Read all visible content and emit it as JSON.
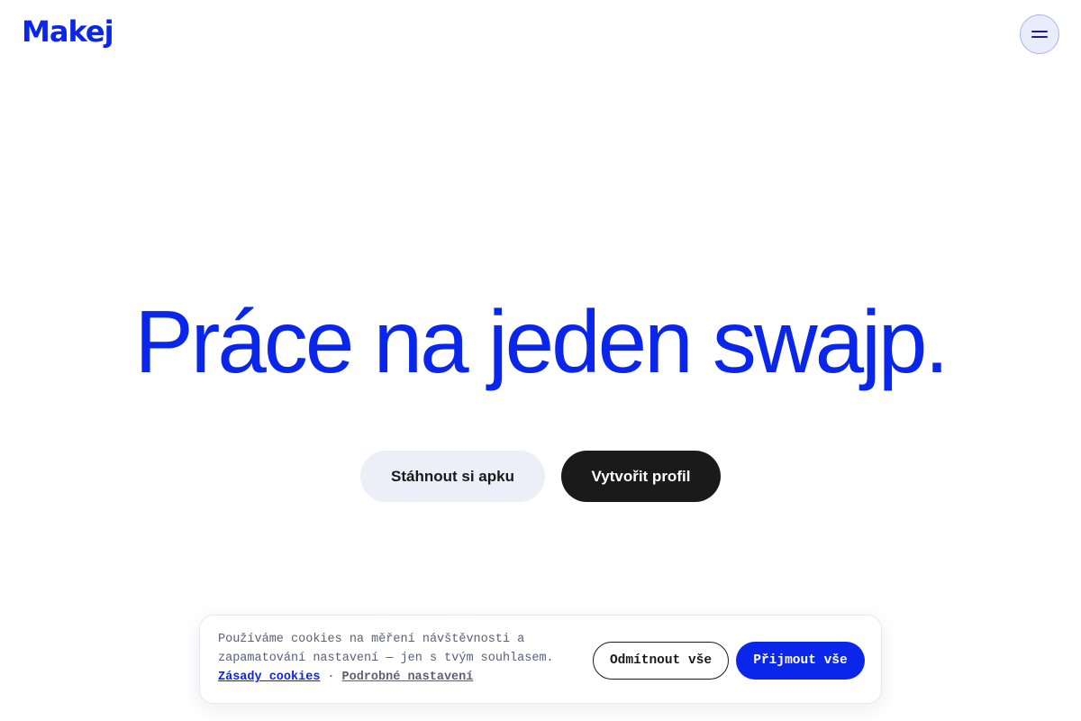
{
  "header": {
    "logo": "Makej",
    "menu_icon": "hamburger-menu-icon"
  },
  "hero": {
    "title": "Práce na jeden swajp.",
    "download_button": "Stáhnout si apku",
    "create_profile_button": "Vytvořit profil"
  },
  "cookie_banner": {
    "text": "Používáme cookies na měření návštěvnosti a zapamatování nastavení — jen s tvým souhlasem.",
    "policy_link": "Zásady cookies",
    "separator": "·",
    "settings_link": "Podrobné nastavení",
    "reject_button": "Odmítnout vše",
    "accept_button": "Přijmout vše"
  },
  "colors": {
    "brand": "#0a26ea",
    "dark": "#1a1a1a",
    "light": "#eceef8"
  }
}
